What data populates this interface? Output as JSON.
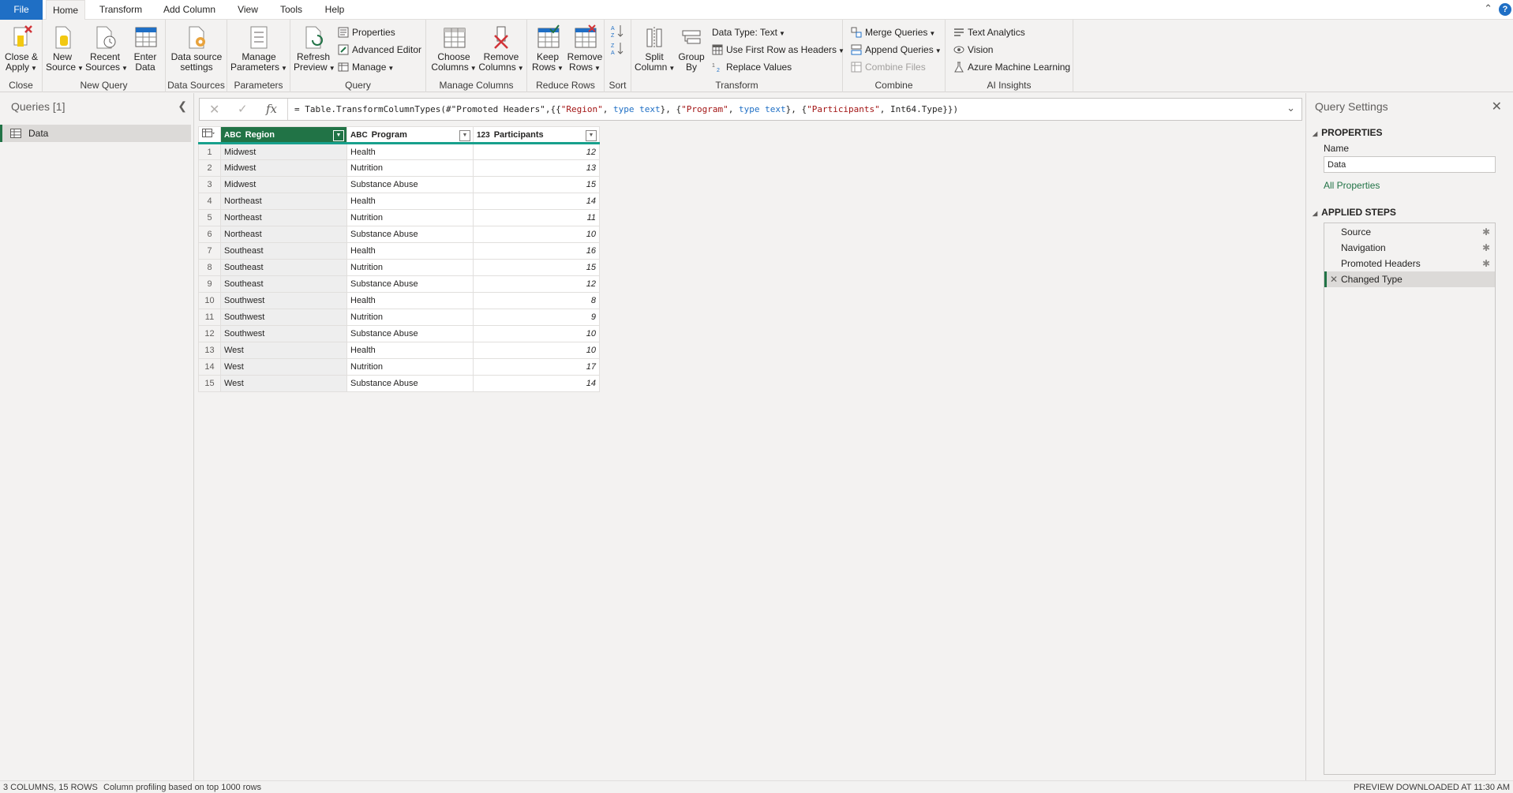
{
  "menu": {
    "tabs": [
      "File",
      "Home",
      "Transform",
      "Add Column",
      "View",
      "Tools",
      "Help"
    ],
    "active": "Home"
  },
  "ribbon": {
    "close": {
      "close_apply": [
        "Close &",
        "Apply"
      ],
      "label": "Close"
    },
    "new_query": {
      "new_source": [
        "New",
        "Source"
      ],
      "recent_sources": [
        "Recent",
        "Sources"
      ],
      "enter_data": [
        "Enter",
        "Data"
      ],
      "label": "New Query"
    },
    "data_sources": {
      "settings": [
        "Data source",
        "settings"
      ],
      "label": "Data Sources"
    },
    "parameters": {
      "manage": [
        "Manage",
        "Parameters"
      ],
      "label": "Parameters"
    },
    "query": {
      "refresh": [
        "Refresh",
        "Preview"
      ],
      "properties": "Properties",
      "advanced_editor": "Advanced Editor",
      "manage": "Manage",
      "label": "Query"
    },
    "manage_columns": {
      "choose": [
        "Choose",
        "Columns"
      ],
      "remove": [
        "Remove",
        "Columns"
      ],
      "label": "Manage Columns"
    },
    "reduce_rows": {
      "keep": [
        "Keep",
        "Rows"
      ],
      "remove": [
        "Remove",
        "Rows"
      ],
      "label": "Reduce Rows"
    },
    "sort": {
      "label": "Sort"
    },
    "transform": {
      "split": [
        "Split",
        "Column"
      ],
      "group": [
        "Group",
        "By"
      ],
      "data_type": "Data Type: Text",
      "first_row": "Use First Row as Headers",
      "replace": "Replace Values",
      "label": "Transform"
    },
    "combine": {
      "merge": "Merge Queries",
      "append": "Append Queries",
      "combine_files": "Combine Files",
      "label": "Combine"
    },
    "ai": {
      "text_analytics": "Text Analytics",
      "vision": "Vision",
      "azure_ml": "Azure Machine Learning",
      "label": "AI Insights"
    }
  },
  "queries_pane": {
    "header": "Queries [1]",
    "items": [
      "Data"
    ]
  },
  "formula": {
    "prefix": "= Table.TransformColumnTypes(#\"Promoted Headers\",{{",
    "s1": "\"Region\"",
    "c1": ", ",
    "k1": "type text",
    "m1": "}, {",
    "s2": "\"Program\"",
    "c2": ", ",
    "k2": "type text",
    "m2": "}, {",
    "s3": "\"Participants\"",
    "tail": ", Int64.Type}})"
  },
  "table": {
    "columns": [
      {
        "name": "Region",
        "type": "ABC"
      },
      {
        "name": "Program",
        "type": "ABC"
      },
      {
        "name": "Participants",
        "type": "123"
      }
    ],
    "rows": [
      [
        "Midwest",
        "Health",
        12
      ],
      [
        "Midwest",
        "Nutrition",
        13
      ],
      [
        "Midwest",
        "Substance Abuse",
        15
      ],
      [
        "Northeast",
        "Health",
        14
      ],
      [
        "Northeast",
        "Nutrition",
        11
      ],
      [
        "Northeast",
        "Substance Abuse",
        10
      ],
      [
        "Southeast",
        "Health",
        16
      ],
      [
        "Southeast",
        "Nutrition",
        15
      ],
      [
        "Southeast",
        "Substance Abuse",
        12
      ],
      [
        "Southwest",
        "Health",
        8
      ],
      [
        "Southwest",
        "Nutrition",
        9
      ],
      [
        "Southwest",
        "Substance Abuse",
        10
      ],
      [
        "West",
        "Health",
        10
      ],
      [
        "West",
        "Nutrition",
        17
      ],
      [
        "West",
        "Substance Abuse",
        14
      ]
    ]
  },
  "settings": {
    "title": "Query Settings",
    "properties_header": "PROPERTIES",
    "name_label": "Name",
    "name_value": "Data",
    "all_properties": "All Properties",
    "steps_header": "APPLIED STEPS",
    "steps": [
      "Source",
      "Navigation",
      "Promoted Headers",
      "Changed Type"
    ],
    "active_step": "Changed Type"
  },
  "status": {
    "summary": "3 COLUMNS, 15 ROWS",
    "profiling": "Column profiling based on top 1000 rows",
    "preview": "PREVIEW DOWNLOADED AT 11:30 AM"
  },
  "colors": {
    "accent": "#217346",
    "file_tab": "#1f6fc5",
    "header_bar": "#18a08c"
  }
}
